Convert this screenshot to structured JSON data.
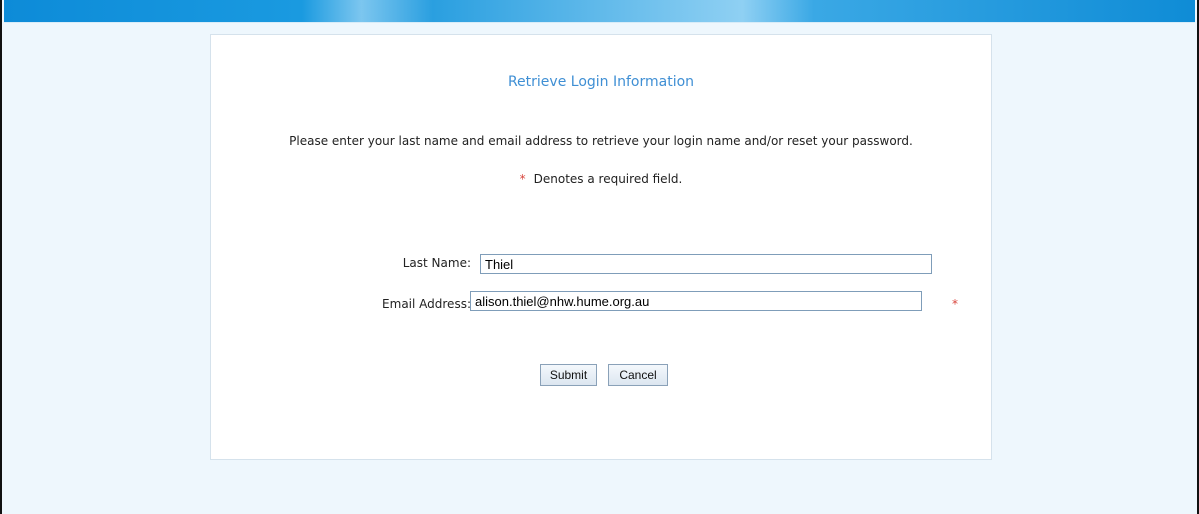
{
  "page": {
    "title": "Retrieve Login Information",
    "instructions": "Please enter your last name and email address to retrieve your login name and/or reset your password.",
    "required_note": {
      "symbol": "*",
      "text": "Denotes a required field."
    }
  },
  "form": {
    "last_name": {
      "label": "Last Name:",
      "value": "Thiel"
    },
    "email": {
      "label": "Email Address:",
      "value": "alison.thiel@nhw.hume.org.au",
      "required_marker": "*"
    }
  },
  "buttons": {
    "submit_label": "Submit",
    "cancel_label": "Cancel"
  },
  "colors": {
    "title": "#3f8fd4",
    "required": "#d8453c",
    "page_background": "#eef7fd",
    "header_bar": "#0d8bd8"
  }
}
